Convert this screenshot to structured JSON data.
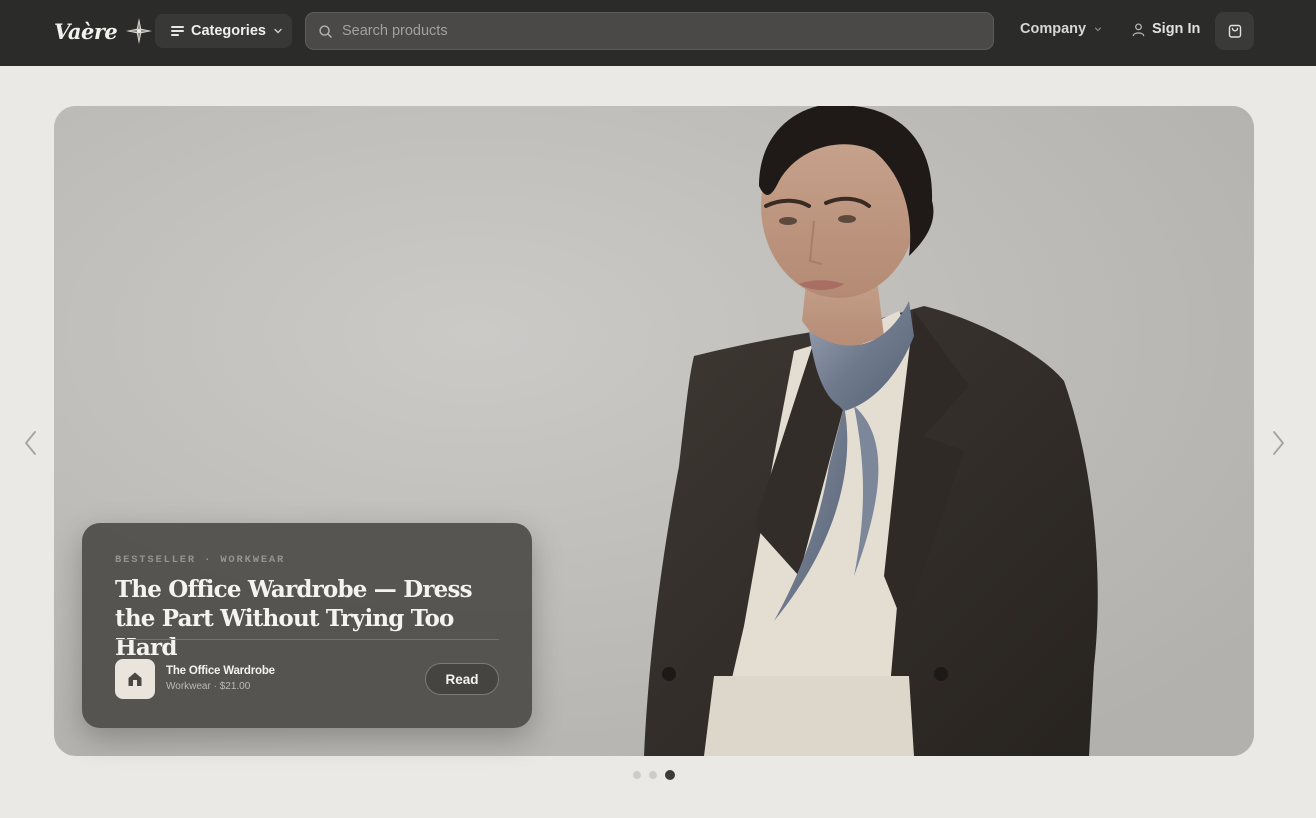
{
  "brand": {
    "name": "Vaère",
    "logo_icon": "four-point-star-icon"
  },
  "nav": {
    "categories_label": "Categories",
    "search_placeholder": "Search products",
    "company_label": "Company",
    "signin_label": "Sign In",
    "cart_icon": "shopping-bag-icon"
  },
  "hero": {
    "eyebrow": "BESTSELLER · WORKWEAR",
    "title": "The Office Wardrobe — Dress the Part Without Trying Too Hard",
    "product": {
      "name": "The Office Wardrobe",
      "meta": "Workwear · $21.00",
      "icon": "store-icon"
    },
    "cta_label": "Read",
    "slide_count": 3,
    "active_slide": 3
  },
  "colors": {
    "header_bg": "#2b2b2a",
    "page_bg": "#ebe9e6",
    "card_bg": "#4e4c49",
    "accent_text": "#f5f3ef"
  }
}
